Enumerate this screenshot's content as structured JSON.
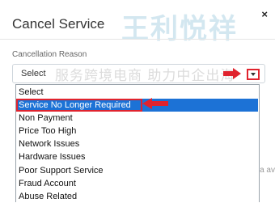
{
  "watermark": {
    "text": "王利悦祥",
    "subtext": "服务跨境电商 助力中企出海"
  },
  "modal": {
    "title": "Cancel Service",
    "close_glyph": "×",
    "field_label": "Cancellation Reason",
    "select_value": "Select",
    "options": [
      "Select",
      "Service No Longer Required",
      "Non Payment",
      "Price Too High",
      "Network Issues",
      "Hardware Issues",
      "Poor Support Service",
      "Fraud Account",
      "Abuse Related"
    ],
    "selected_index": 1,
    "footer_partial": "a av"
  },
  "colors": {
    "highlight": "#1c72d6",
    "annotation": "#e0232e"
  },
  "icons": {
    "close": "close-icon",
    "caret": "chevron-down-icon",
    "pointer": "red-arrow-icon"
  }
}
